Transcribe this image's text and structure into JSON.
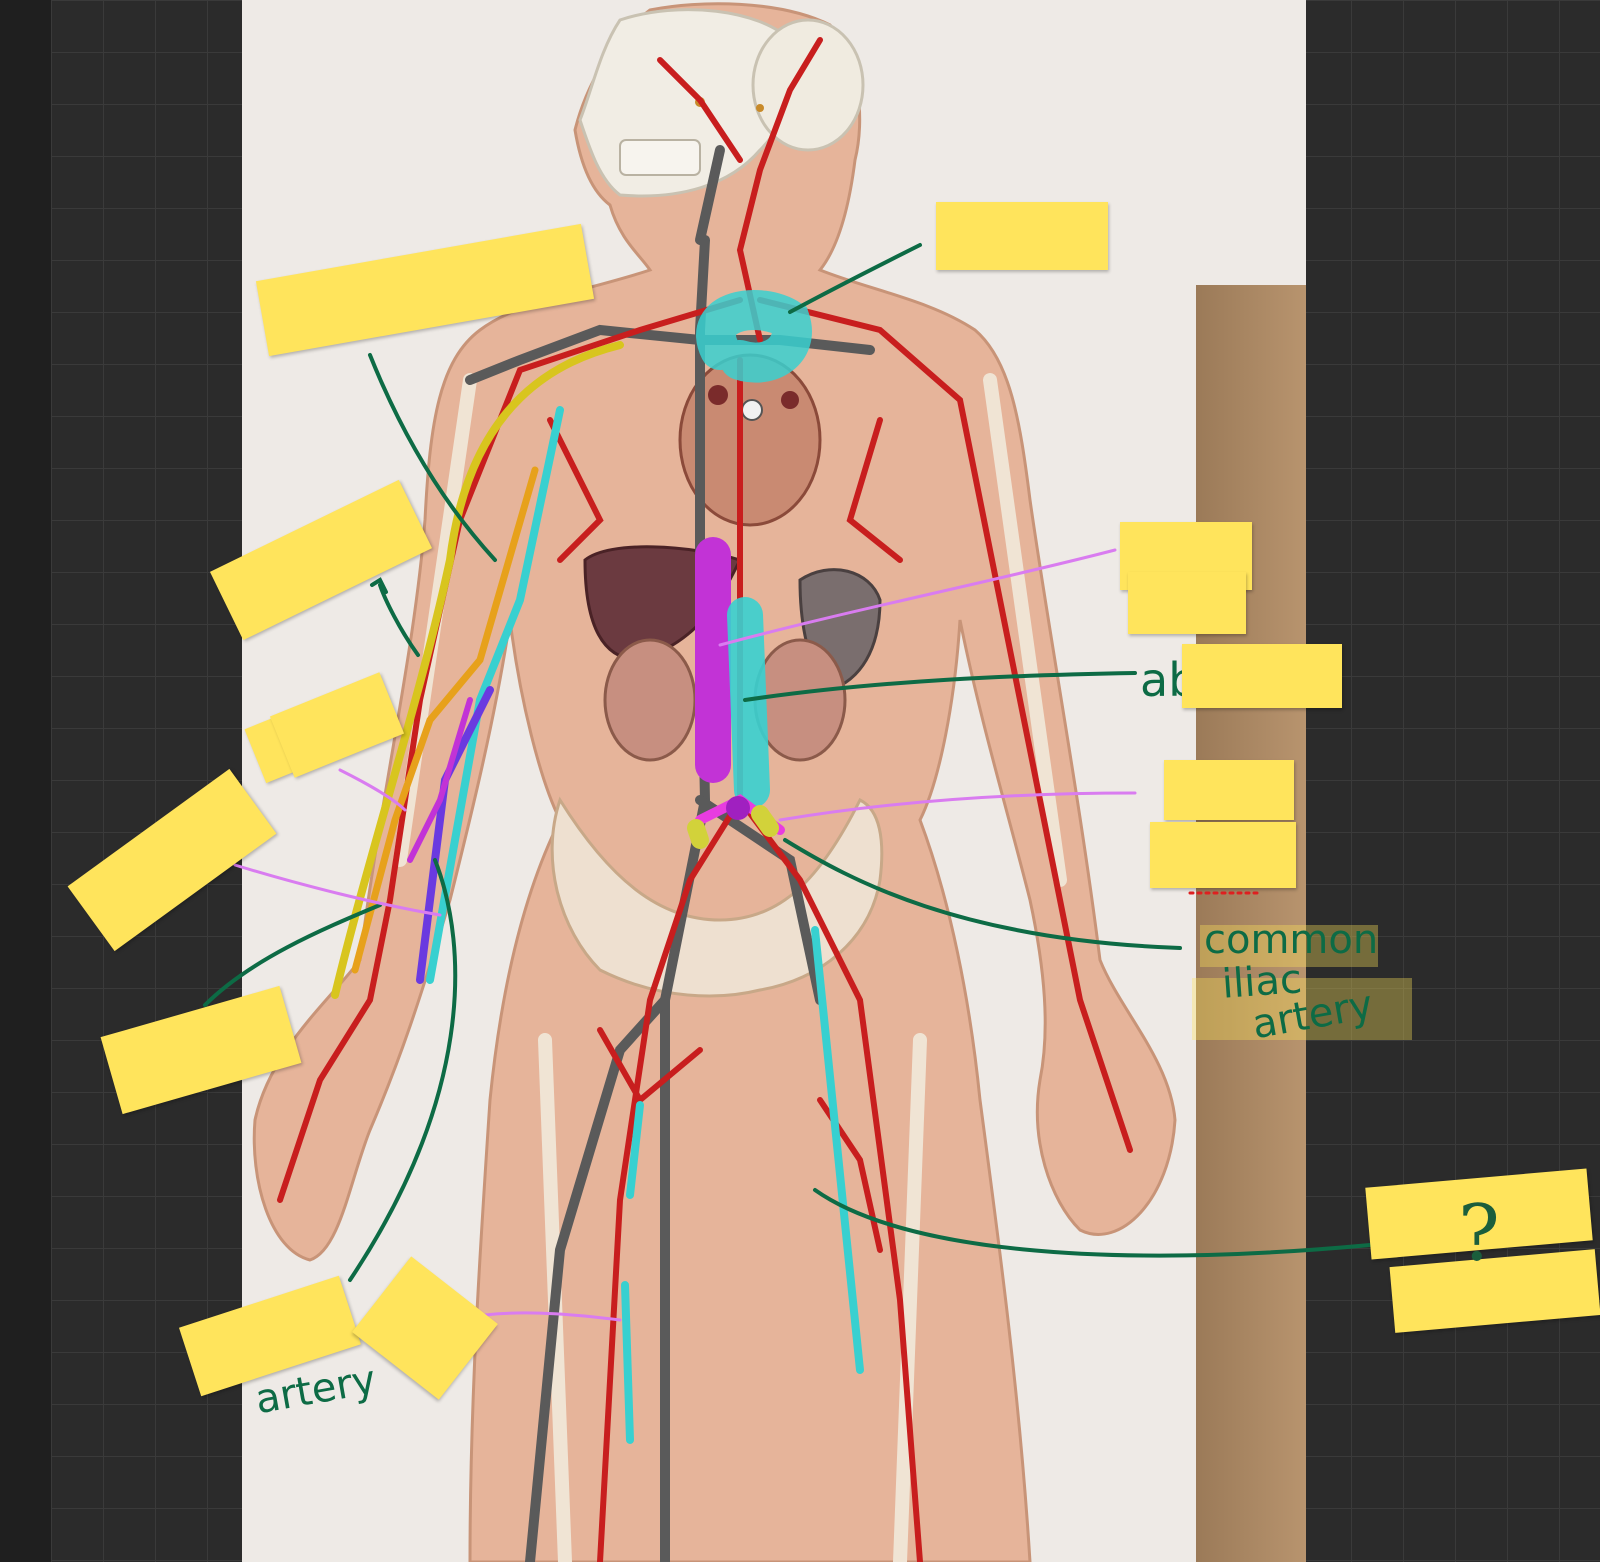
{
  "canvas": {
    "background": "#2a2a2a",
    "grid_color": "#3a3a3a"
  },
  "colors": {
    "sticky": "#ffe45c",
    "ink_green": "#0d6b45",
    "ink_pink": "#d97cf0",
    "artery_red": "#c81e1e",
    "vein_gray": "#555555",
    "highlight_cyan": "#38d0d0",
    "highlight_magenta": "#c233d6",
    "highlight_yellow": "#e3d52a"
  },
  "labels": {
    "abdominal_partial": "ab",
    "common_iliac_line1": "common",
    "common_iliac_line2": "iliac",
    "common_iliac_line3": "artery",
    "arm_partial": "artery",
    "question_mark": "?"
  },
  "stickies": [
    {
      "id": "sticky-1"
    },
    {
      "id": "sticky-2"
    },
    {
      "id": "sticky-3"
    },
    {
      "id": "sticky-4"
    },
    {
      "id": "sticky-5"
    },
    {
      "id": "sticky-6"
    },
    {
      "id": "sticky-7"
    },
    {
      "id": "sticky-8"
    },
    {
      "id": "sticky-9"
    },
    {
      "id": "sticky-10"
    },
    {
      "id": "sticky-11"
    },
    {
      "id": "sticky-12"
    },
    {
      "id": "sticky-13"
    },
    {
      "id": "sticky-14"
    }
  ],
  "icons": {
    "question": "question-mark-icon",
    "arrow": "curved-arrow-icon"
  }
}
